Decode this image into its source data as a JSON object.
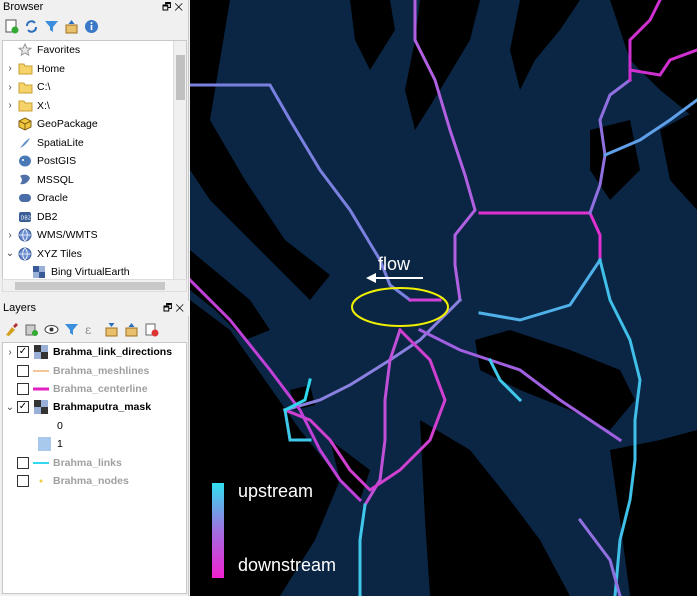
{
  "browser": {
    "title": "Browser",
    "items": [
      {
        "label": "Favorites",
        "icon": "star-icon",
        "arrow": ""
      },
      {
        "label": "Home",
        "icon": "folder-icon",
        "arrow": "›"
      },
      {
        "label": "C:\\",
        "icon": "folder-icon",
        "arrow": "›"
      },
      {
        "label": "X:\\",
        "icon": "folder-icon",
        "arrow": "›"
      },
      {
        "label": "GeoPackage",
        "icon": "geopackage-icon",
        "arrow": ""
      },
      {
        "label": "SpatiaLite",
        "icon": "spatialite-icon",
        "arrow": ""
      },
      {
        "label": "PostGIS",
        "icon": "postgis-icon",
        "arrow": ""
      },
      {
        "label": "MSSQL",
        "icon": "mssql-icon",
        "arrow": ""
      },
      {
        "label": "Oracle",
        "icon": "oracle-icon",
        "arrow": ""
      },
      {
        "label": "DB2",
        "icon": "db2-icon",
        "arrow": ""
      },
      {
        "label": "WMS/WMTS",
        "icon": "globe-icon",
        "arrow": "›"
      },
      {
        "label": "XYZ Tiles",
        "icon": "globe-icon",
        "arrow": "⌄"
      },
      {
        "label": "Bing VirtualEarth",
        "icon": "tile-icon",
        "arrow": ""
      }
    ]
  },
  "layers": {
    "title": "Layers",
    "items": [
      {
        "name": "Brahma_link_directions",
        "checked": true,
        "style": "bold",
        "arrow": "›",
        "symbol": "raster"
      },
      {
        "name": "Brahma_meshlines",
        "checked": false,
        "style": "gray",
        "arrow": "",
        "symbol": "line-orange"
      },
      {
        "name": "Brahma_centerline",
        "checked": false,
        "style": "gray",
        "arrow": "",
        "symbol": "line-magenta"
      },
      {
        "name": "Brahmaputra_mask",
        "checked": true,
        "style": "bold",
        "arrow": "⌄",
        "symbol": "raster"
      },
      {
        "name": "0",
        "checked": null,
        "style": "plain",
        "arrow": "",
        "symbol": "none"
      },
      {
        "name": "1",
        "checked": null,
        "style": "plain",
        "arrow": "",
        "symbol": "swatch-blue"
      },
      {
        "name": "Brahma_links",
        "checked": false,
        "style": "gray",
        "arrow": "",
        "symbol": "line-cyan"
      },
      {
        "name": "Brahma_nodes",
        "checked": false,
        "style": "gray",
        "arrow": "",
        "symbol": "dot-yellow"
      }
    ]
  },
  "map": {
    "flow_label": "flow",
    "legend_upstream": "upstream",
    "legend_downstream": "downstream",
    "colors": {
      "water": "#0b2644",
      "land": "#000000",
      "upstream": "#30e0f0",
      "downstream": "#f020d0",
      "ellipse": "#f0f000"
    }
  }
}
